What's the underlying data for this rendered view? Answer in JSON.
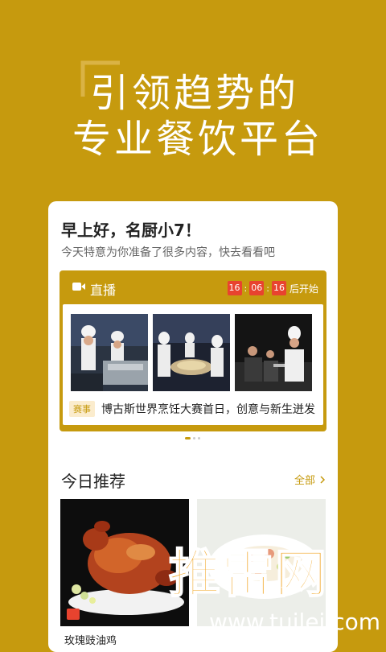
{
  "hero": {
    "line1": "引领趋势的",
    "line2": "专业餐饮平台"
  },
  "greeting": {
    "title": "早上好，名厨小7！",
    "subtitle": "今天特意为你准备了很多内容，快去看看吧"
  },
  "live": {
    "title": "直播",
    "icon": "video-camera-icon",
    "countdown": {
      "hours": "16",
      "minutes": "06",
      "seconds": "16",
      "suffix": "后开始"
    },
    "tag": "赛事",
    "caption": "博古斯世界烹饪大赛首日，创意与新生迸发"
  },
  "recommend": {
    "title": "今日推荐",
    "all_label": "全部",
    "items": [
      {
        "name": "玫瑰豉油鸡"
      },
      {
        "name": ""
      }
    ]
  },
  "watermark": {
    "text": "推雷网",
    "url": "www.tuilei.com"
  },
  "colors": {
    "brand": "#c69a0e",
    "countdown_bg": "#e8432f",
    "watermark": "#f0a018"
  }
}
